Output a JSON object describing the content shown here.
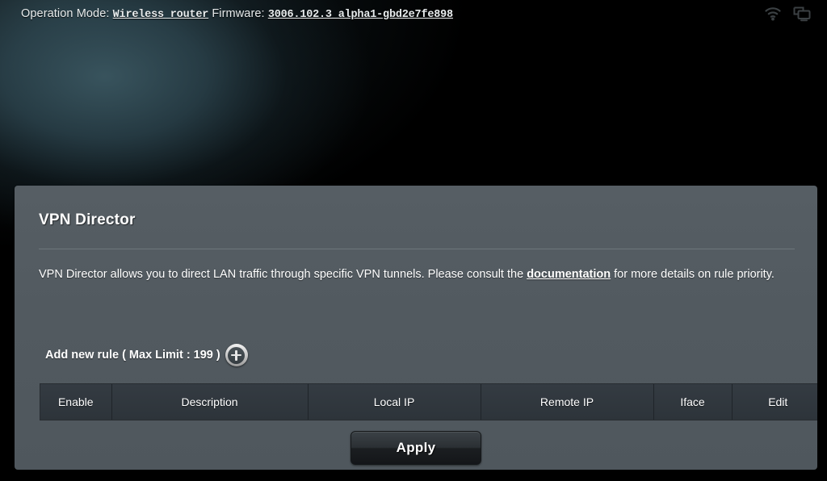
{
  "topbar": {
    "operation_mode_label": "Operation Mode:",
    "operation_mode_value": "Wireless router",
    "firmware_label": "Firmware:",
    "firmware_value": "3006.102.3_alpha1-gbd2e7fe898",
    "icons": [
      "wifi-icon",
      "clients-devices-icon"
    ]
  },
  "panel": {
    "title": "VPN Director",
    "description_part1": "VPN Director allows you to direct LAN traffic through specific VPN tunnels. Please consult the ",
    "description_link": "documentation",
    "description_part2": " for more details on rule priority.",
    "add_rule_label": "Add new rule ( Max Limit : 199 )",
    "add_rule_icon": "plus-circle-icon",
    "table": {
      "headers": [
        "Enable",
        "Description",
        "Local IP",
        "Remote IP",
        "Iface",
        "Edit"
      ],
      "rows": []
    },
    "apply_label": "Apply"
  },
  "colors": {
    "panel_bg": "#525a60",
    "table_header_bg": "#2f353c",
    "page_bg": "#000000",
    "glow": "#3a5660",
    "text": "#ffffff"
  }
}
